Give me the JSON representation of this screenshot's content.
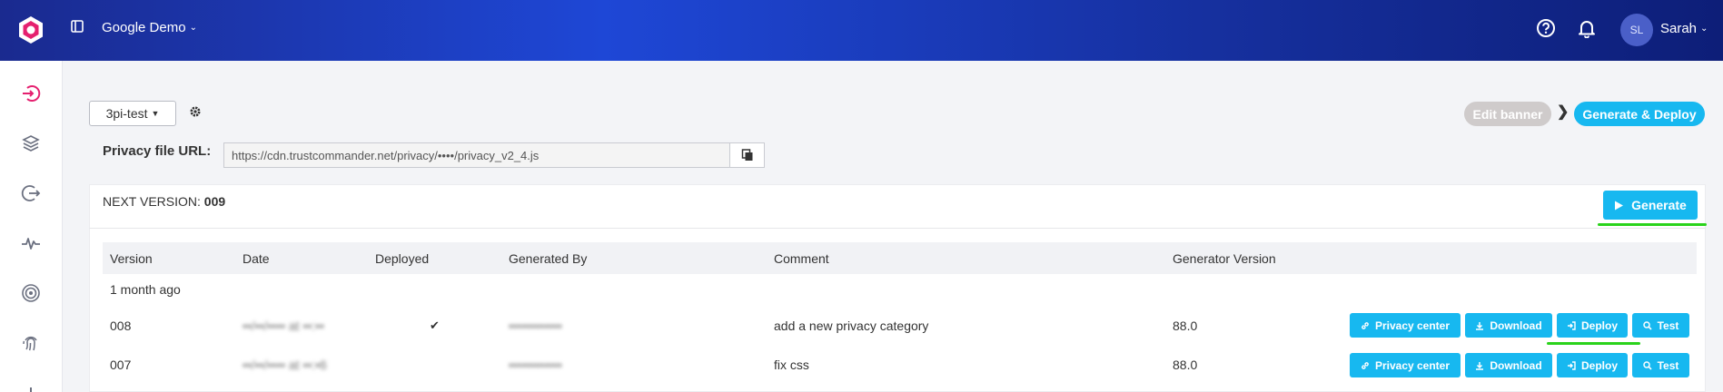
{
  "header": {
    "workspace": "Google Demo",
    "user_initials": "SL",
    "user_name": "Sarah"
  },
  "toolbar": {
    "environment": "3pi-test",
    "edit_banner": "Edit banner",
    "generate_deploy": "Generate & Deploy"
  },
  "privacy_file": {
    "label": "Privacy file URL:",
    "url": "https://cdn.trustcommander.net/privacy/••••/privacy_v2_4.js"
  },
  "versions_panel": {
    "next_version_label": "NEXT VERSION:",
    "next_version_value": "009",
    "generate_label": "Generate",
    "columns": [
      "Version",
      "Date",
      "Deployed",
      "Generated By",
      "Comment",
      "Generator Version"
    ],
    "group_label": "1 month ago",
    "rows": [
      {
        "version": "008",
        "date": "••/••/•••• at ••:••",
        "deployed": true,
        "generated_by": "••••••••••••",
        "comment": "add a new privacy category",
        "generator_version": "88.0"
      },
      {
        "version": "007",
        "date": "••/••/•••• at ••:•6",
        "deployed": false,
        "generated_by": "••••••••••••",
        "comment": "fix css",
        "generator_version": "88.0"
      }
    ],
    "actions": {
      "privacy_center": "Privacy center",
      "download": "Download",
      "deploy": "Deploy",
      "test": "Test"
    }
  },
  "colors": {
    "accent": "#17b8f0",
    "brand_pink": "#e5206f",
    "highlight_green": "#2ad31b"
  }
}
